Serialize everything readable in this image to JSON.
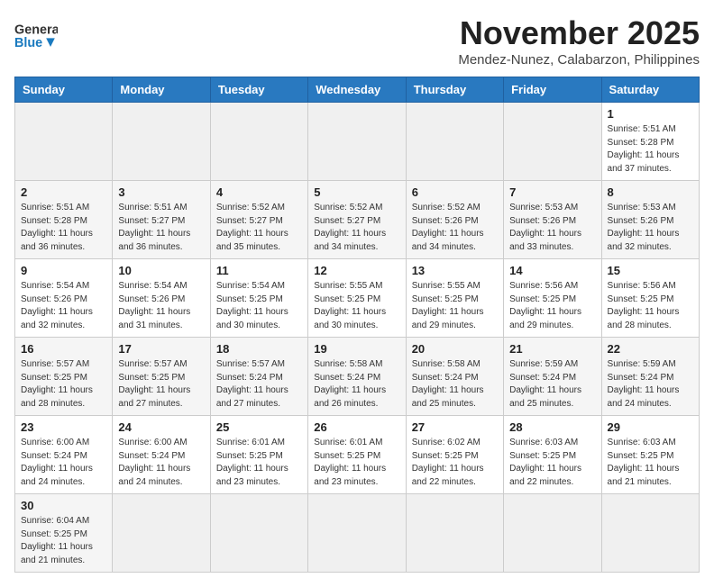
{
  "header": {
    "logo_general": "General",
    "logo_blue": "Blue",
    "month_title": "November 2025",
    "location": "Mendez-Nunez, Calabarzon, Philippines"
  },
  "weekdays": [
    "Sunday",
    "Monday",
    "Tuesday",
    "Wednesday",
    "Thursday",
    "Friday",
    "Saturday"
  ],
  "weeks": [
    [
      null,
      null,
      null,
      null,
      null,
      null,
      {
        "day": "1",
        "sunrise": "5:51 AM",
        "sunset": "5:28 PM",
        "daylight": "11 hours and 37 minutes."
      }
    ],
    [
      {
        "day": "2",
        "sunrise": "5:51 AM",
        "sunset": "5:28 PM",
        "daylight": "11 hours and 36 minutes."
      },
      {
        "day": "3",
        "sunrise": "5:51 AM",
        "sunset": "5:27 PM",
        "daylight": "11 hours and 36 minutes."
      },
      {
        "day": "4",
        "sunrise": "5:52 AM",
        "sunset": "5:27 PM",
        "daylight": "11 hours and 35 minutes."
      },
      {
        "day": "5",
        "sunrise": "5:52 AM",
        "sunset": "5:27 PM",
        "daylight": "11 hours and 34 minutes."
      },
      {
        "day": "6",
        "sunrise": "5:52 AM",
        "sunset": "5:26 PM",
        "daylight": "11 hours and 34 minutes."
      },
      {
        "day": "7",
        "sunrise": "5:53 AM",
        "sunset": "5:26 PM",
        "daylight": "11 hours and 33 minutes."
      },
      {
        "day": "8",
        "sunrise": "5:53 AM",
        "sunset": "5:26 PM",
        "daylight": "11 hours and 32 minutes."
      }
    ],
    [
      {
        "day": "9",
        "sunrise": "5:54 AM",
        "sunset": "5:26 PM",
        "daylight": "11 hours and 32 minutes."
      },
      {
        "day": "10",
        "sunrise": "5:54 AM",
        "sunset": "5:26 PM",
        "daylight": "11 hours and 31 minutes."
      },
      {
        "day": "11",
        "sunrise": "5:54 AM",
        "sunset": "5:25 PM",
        "daylight": "11 hours and 30 minutes."
      },
      {
        "day": "12",
        "sunrise": "5:55 AM",
        "sunset": "5:25 PM",
        "daylight": "11 hours and 30 minutes."
      },
      {
        "day": "13",
        "sunrise": "5:55 AM",
        "sunset": "5:25 PM",
        "daylight": "11 hours and 29 minutes."
      },
      {
        "day": "14",
        "sunrise": "5:56 AM",
        "sunset": "5:25 PM",
        "daylight": "11 hours and 29 minutes."
      },
      {
        "day": "15",
        "sunrise": "5:56 AM",
        "sunset": "5:25 PM",
        "daylight": "11 hours and 28 minutes."
      }
    ],
    [
      {
        "day": "16",
        "sunrise": "5:57 AM",
        "sunset": "5:25 PM",
        "daylight": "11 hours and 28 minutes."
      },
      {
        "day": "17",
        "sunrise": "5:57 AM",
        "sunset": "5:25 PM",
        "daylight": "11 hours and 27 minutes."
      },
      {
        "day": "18",
        "sunrise": "5:57 AM",
        "sunset": "5:24 PM",
        "daylight": "11 hours and 27 minutes."
      },
      {
        "day": "19",
        "sunrise": "5:58 AM",
        "sunset": "5:24 PM",
        "daylight": "11 hours and 26 minutes."
      },
      {
        "day": "20",
        "sunrise": "5:58 AM",
        "sunset": "5:24 PM",
        "daylight": "11 hours and 25 minutes."
      },
      {
        "day": "21",
        "sunrise": "5:59 AM",
        "sunset": "5:24 PM",
        "daylight": "11 hours and 25 minutes."
      },
      {
        "day": "22",
        "sunrise": "5:59 AM",
        "sunset": "5:24 PM",
        "daylight": "11 hours and 24 minutes."
      }
    ],
    [
      {
        "day": "23",
        "sunrise": "6:00 AM",
        "sunset": "5:24 PM",
        "daylight": "11 hours and 24 minutes."
      },
      {
        "day": "24",
        "sunrise": "6:00 AM",
        "sunset": "5:24 PM",
        "daylight": "11 hours and 24 minutes."
      },
      {
        "day": "25",
        "sunrise": "6:01 AM",
        "sunset": "5:25 PM",
        "daylight": "11 hours and 23 minutes."
      },
      {
        "day": "26",
        "sunrise": "6:01 AM",
        "sunset": "5:25 PM",
        "daylight": "11 hours and 23 minutes."
      },
      {
        "day": "27",
        "sunrise": "6:02 AM",
        "sunset": "5:25 PM",
        "daylight": "11 hours and 22 minutes."
      },
      {
        "day": "28",
        "sunrise": "6:03 AM",
        "sunset": "5:25 PM",
        "daylight": "11 hours and 22 minutes."
      },
      {
        "day": "29",
        "sunrise": "6:03 AM",
        "sunset": "5:25 PM",
        "daylight": "11 hours and 21 minutes."
      }
    ],
    [
      {
        "day": "30",
        "sunrise": "6:04 AM",
        "sunset": "5:25 PM",
        "daylight": "11 hours and 21 minutes."
      },
      null,
      null,
      null,
      null,
      null,
      null
    ]
  ],
  "labels": {
    "sunrise": "Sunrise:",
    "sunset": "Sunset:",
    "daylight": "Daylight:"
  }
}
